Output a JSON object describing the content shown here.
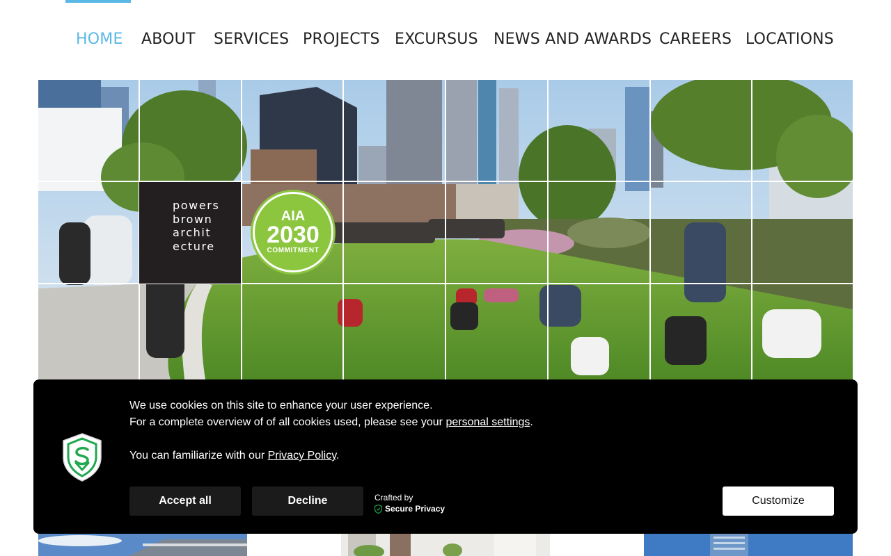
{
  "nav": {
    "items": [
      {
        "label": "HOME",
        "active": true
      },
      {
        "label": "ABOUT"
      },
      {
        "label": "SERVICES"
      },
      {
        "label": "PROJECTS"
      },
      {
        "label": "EXCURSUS"
      },
      {
        "label": "NEWS AND AWARDS"
      },
      {
        "label": "CAREERS"
      },
      {
        "label": "LOCATIONS"
      }
    ]
  },
  "hero": {
    "logo_lines": [
      "powers",
      "brown",
      "archit",
      "ecture"
    ],
    "badge": {
      "top": "AIA",
      "year": "2030",
      "sub": "COMMITMENT"
    }
  },
  "cookie": {
    "line1": "We use cookies on this site to enhance your user experience.",
    "line2_prefix": "For a complete overview of of all cookies used, please see your ",
    "line2_link": "personal settings",
    "line2_suffix": ".",
    "line3_prefix": "You can familiarize with our ",
    "line3_link": "Privacy Policy",
    "line3_suffix": ".",
    "accept_label": "Accept all",
    "decline_label": "Decline",
    "crafted_by": "Crafted by",
    "crafted_brand": "Secure Privacy",
    "customize_label": "Customize"
  },
  "colors": {
    "accent": "#5ab8e6",
    "nav_text": "#222222",
    "banner_bg": "#000000",
    "button_dark": "#1b1b1b",
    "badge_green": "#8cc63f",
    "shield_green": "#1fa84f"
  }
}
